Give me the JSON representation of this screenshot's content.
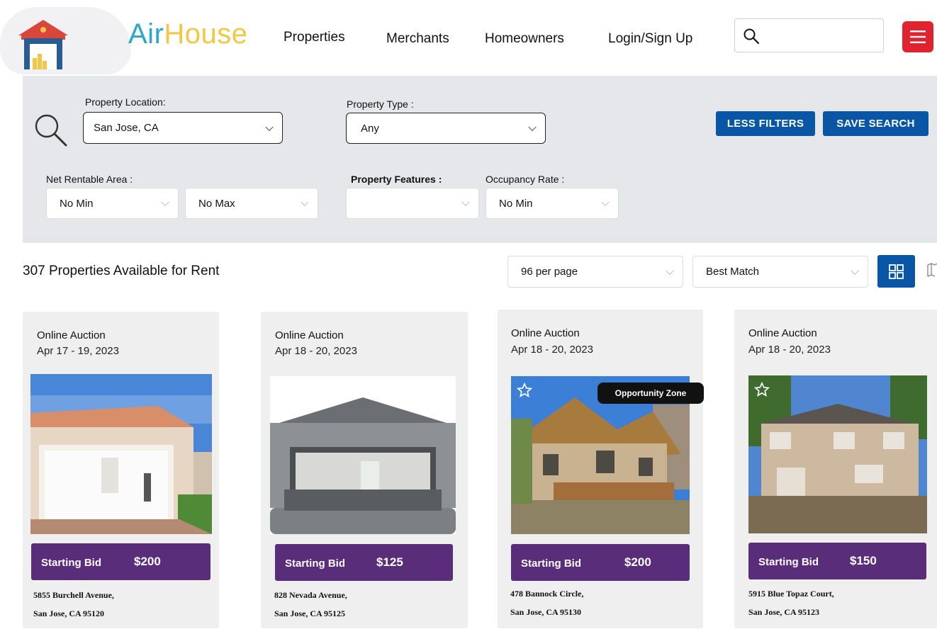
{
  "header": {
    "logo_part1": "Air",
    "logo_part2": "House",
    "nav": [
      "Properties",
      "Merchants",
      "Homeowners",
      "Login/Sign Up"
    ],
    "search_icon": "search-icon",
    "menu_icon": "hamburger-menu-icon"
  },
  "filters": {
    "location_label": "Property Location:",
    "location_value": "San Jose, CA",
    "type_label": "Property Type :",
    "type_value": "Any",
    "less_filters": "LESS FILTERS",
    "save_search": "SAVE SEARCH",
    "area_label": "Net Rentable Area :",
    "area_min": "No Min",
    "area_max": "No Max",
    "features_label": "Property Features :",
    "features_value": "",
    "occupancy_label": "Occupancy Rate :",
    "occupancy_value": "No Min"
  },
  "results": {
    "count_text": "307 Properties Available for Rent",
    "per_page": "96 per page",
    "sort": "Best Match"
  },
  "colors": {
    "brand_blue": "#0a56a6",
    "bid_purple": "#5a2d7a",
    "menu_red": "#e0232e",
    "logo_teal": "#2aa7c9",
    "logo_yellow": "#f2c744"
  },
  "cards": [
    {
      "type": "Online Auction",
      "date": "Apr 17 - 19, 2023",
      "bid_label": "Starting Bid",
      "price": "$200",
      "addr1": "5855 Burchell Avenue,",
      "addr2": "San Jose, CA 95120",
      "badge": ""
    },
    {
      "type": "Online Auction",
      "date": "Apr 18 - 20, 2023",
      "bid_label": "Starting Bid",
      "price": "$125",
      "addr1": "828 Nevada Avenue,",
      "addr2": "San Jose, CA 95125",
      "badge": ""
    },
    {
      "type": "Online Auction",
      "date": "Apr 18 - 20, 2023",
      "bid_label": "Starting Bid",
      "price": "$200",
      "addr1": "478 Bannock Circle,",
      "addr2": "San Jose, CA 95130",
      "badge": "Opportunity Zone"
    },
    {
      "type": "Online Auction",
      "date": "Apr 18 - 20, 2023",
      "bid_label": "Starting Bid",
      "price": "$150",
      "addr1": "5915 Blue Topaz Court,",
      "addr2": "San Jose, CA 95123",
      "badge": ""
    }
  ]
}
